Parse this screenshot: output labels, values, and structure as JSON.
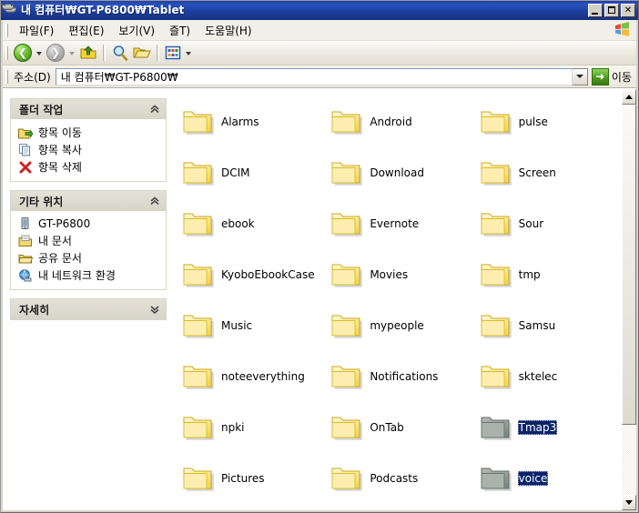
{
  "window": {
    "title": "내 컴퓨터₩GT-P6800₩Tablet",
    "icon": "my-computer-icon",
    "buttons": {
      "minimize": "_",
      "maximize": "□",
      "close": "✕"
    }
  },
  "menubar": {
    "items": [
      {
        "label": "파일(F)",
        "accel": "F"
      },
      {
        "label": "편집(E)",
        "accel": "E"
      },
      {
        "label": "보기(V)",
        "accel": "V"
      },
      {
        "label": "즐T)",
        "accel": "T"
      },
      {
        "label": "도움말(H)",
        "accel": "H"
      }
    ]
  },
  "toolbar": {
    "back": "뒤로",
    "forward": "앞으로",
    "up": "위로",
    "search": "검색",
    "folders": "폴더",
    "views": "보기"
  },
  "addressbar": {
    "label": "주소(D)",
    "value": "내 컴퓨터₩GT-P6800₩",
    "go_label": "이동"
  },
  "sidebar": {
    "panels": [
      {
        "title": "폴더 작업",
        "collapse_state": "expanded",
        "items": [
          {
            "label": "항목 이동",
            "icon": "move-item-icon"
          },
          {
            "label": "항목 복사",
            "icon": "copy-item-icon"
          },
          {
            "label": "항목 삭제",
            "icon": "delete-item-icon"
          }
        ]
      },
      {
        "title": "기타 위치",
        "collapse_state": "expanded",
        "items": [
          {
            "label": "GT-P6800",
            "icon": "device-icon"
          },
          {
            "label": "내 문서",
            "icon": "my-documents-icon"
          },
          {
            "label": "공유 문서",
            "icon": "shared-documents-icon"
          },
          {
            "label": "내 네트워크 환경",
            "icon": "network-icon"
          }
        ]
      },
      {
        "title": "자세히",
        "collapse_state": "collapsed",
        "items": []
      }
    ]
  },
  "content": {
    "view_mode": "icons",
    "rows": [
      [
        {
          "name": "Alarms",
          "selected": false
        },
        {
          "name": "Android",
          "selected": false
        },
        {
          "name": "pulse",
          "selected": false
        }
      ],
      [
        {
          "name": "DCIM",
          "selected": false
        },
        {
          "name": "Download",
          "selected": false
        },
        {
          "name": "Screen",
          "selected": false
        }
      ],
      [
        {
          "name": "ebook",
          "selected": false
        },
        {
          "name": "Evernote",
          "selected": false
        },
        {
          "name": "Sour",
          "selected": false
        }
      ],
      [
        {
          "name": "KyoboEbookCase",
          "selected": false
        },
        {
          "name": "Movies",
          "selected": false
        },
        {
          "name": "tmp",
          "selected": false
        }
      ],
      [
        {
          "name": "Music",
          "selected": false
        },
        {
          "name": "mypeople",
          "selected": false
        },
        {
          "name": "Samsu",
          "selected": false
        }
      ],
      [
        {
          "name": "noteeverything",
          "selected": false
        },
        {
          "name": "Notifications",
          "selected": false
        },
        {
          "name": "sktelec",
          "selected": false
        }
      ],
      [
        {
          "name": "npki",
          "selected": false
        },
        {
          "name": "OnTab",
          "selected": false
        },
        {
          "name": "Tmap3",
          "selected": true
        }
      ],
      [
        {
          "name": "Pictures",
          "selected": false
        },
        {
          "name": "Podcasts",
          "selected": false
        },
        {
          "name": "voice",
          "selected": true
        }
      ]
    ]
  },
  "scrollbar": {
    "up_arrow": "▲",
    "down_arrow": "▼",
    "thumb_position_percent": 0,
    "thumb_size_percent": 82
  },
  "colors": {
    "titlebar_blue": "#2a52be",
    "selection_blue": "#0a246a",
    "folder_yellow": "#fde98a",
    "panel_header": "#dedbd0",
    "window_face": "#d6d3ce"
  }
}
